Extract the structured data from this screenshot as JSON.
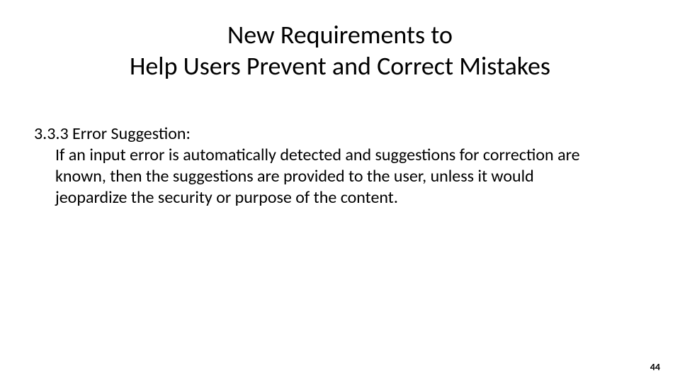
{
  "slide": {
    "title": "New Requirements to\nHelp Users Prevent and Correct Mistakes",
    "section": {
      "heading": "3.3.3 Error Suggestion:",
      "body": "If an input error is automatically detected and suggestions for correction are known, then the suggestions are provided to the user, unless it would jeopardize the security or purpose of the content."
    },
    "page_number": "44"
  }
}
